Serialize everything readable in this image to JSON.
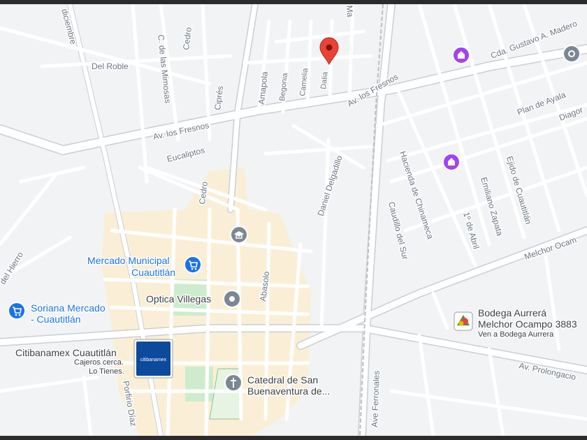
{
  "streets": {
    "diciembre": "diciembre",
    "del_roble": "Del Roble",
    "mimosas": "C. de las Mimosas",
    "cedro_top": "Cedro",
    "cipres": "Ciprés",
    "amapola": "Amapola",
    "begonia": "Begonia",
    "camelia": "Camelia",
    "dalia": "Dalia",
    "madero_top": "Ma",
    "los_fresnos_w": "Av. los Fresnos",
    "los_fresnos_e": "Av. los Fresnos",
    "eucaliptos": "Eucaliptos",
    "cedro_mid": "Cedro",
    "daniel_delgadillo": "Daniel Delgadillo",
    "hacienda": "Hacienda de Chinameca",
    "caudillo": "Caudillo del Sur",
    "abril": "1º de Abril",
    "zapata": "Emiliano Zapata",
    "ejido": "Ejido de Cuautitlán",
    "plan_ayala": "Plan de Ayala",
    "diagonal": "Diagor",
    "gustavo_madero": "Cda. Gustavo A. Madero",
    "melchor": "Melchor Ocam",
    "del_hierro": "del Hierro",
    "abasolo": "Abasolo",
    "porfirio": "Porfirio Díaz",
    "ferronales": "Ave Ferronales",
    "prolongacion": "Av. Prolongacio"
  },
  "places": {
    "mercado_line1": "Mercado Municipal",
    "mercado_line2": "Cuautitlán",
    "soriana_line1": "Soriana Mercado",
    "soriana_line2": "- Cuautitlán",
    "optica": "Optica Villegas",
    "citi_name": "Citibanamex Cuautitlán",
    "citi_sub1": "Cajeros cerca.",
    "citi_sub2": "Lo Tienes.",
    "citi_logo": "citibanamex",
    "catedral_line1": "Catedral de San",
    "catedral_line2": "Buenaventura de...",
    "bodega_line1": "Bodega Aurrerá",
    "bodega_line2": "Melchor Ocampo 3883",
    "bodega_sub": "Ven a Bodega Aurrera"
  },
  "colors": {
    "land": "#f1f3f4",
    "road": "#ffffff",
    "road_outline": "#c5cbd1",
    "highway": "#dde2e6",
    "downtown": "#faefd6",
    "park": "#cdeccd",
    "pin": "#ea4335",
    "poi_blue": "#1a73e8",
    "poi_purple": "#a142f4",
    "citi_blue": "#0d4a9b"
  }
}
